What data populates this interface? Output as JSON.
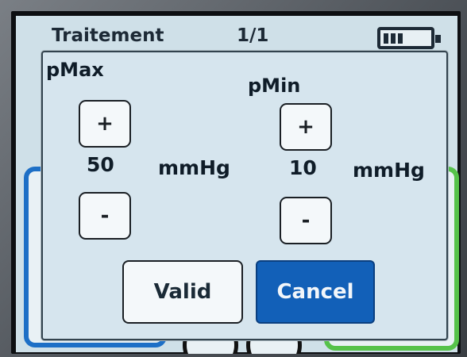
{
  "background": {
    "title": "Traitement",
    "page": "1/1"
  },
  "dialog": {
    "pmax": {
      "label": "pMax",
      "plus": "+",
      "value": "50",
      "unit": "mmHg",
      "minus": "-"
    },
    "pmin": {
      "label": "pMin",
      "plus": "+",
      "value": "10",
      "unit": "mmHg",
      "minus": "-"
    },
    "valid_label": "Valid",
    "cancel_label": "Cancel"
  },
  "colors": {
    "cancel_bg": "#1260b8",
    "panel_blue": "#1d6fc6",
    "panel_green": "#56c24a",
    "dialog_bg": "#d6e5ee"
  }
}
